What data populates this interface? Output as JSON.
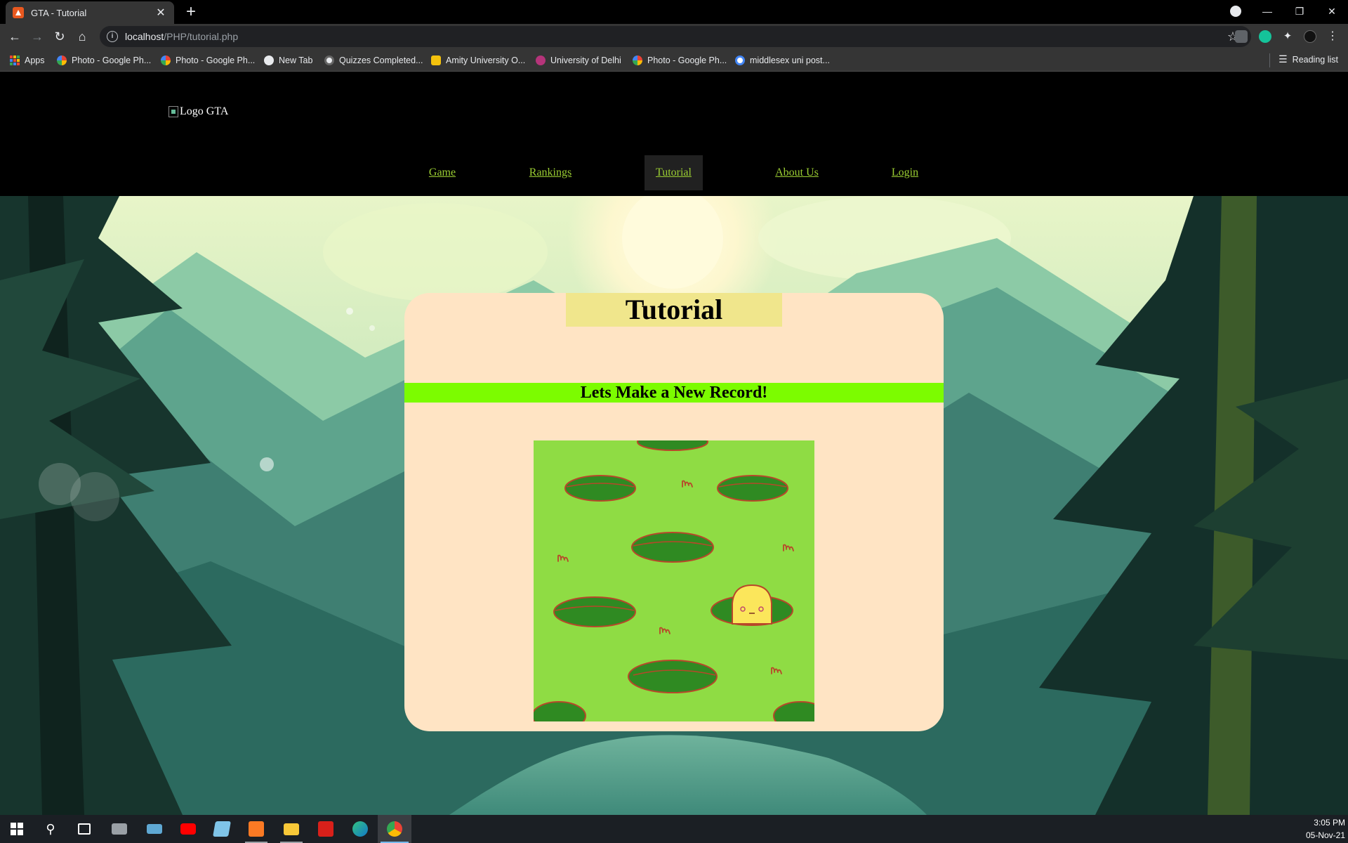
{
  "browser": {
    "tab_title": "GTA - Tutorial",
    "url_host": "localhost",
    "url_path": "/PHP/tutorial.php",
    "bookmarks": [
      {
        "label": "Apps",
        "icon": "apps-grid-icon",
        "color": "#4285f4"
      },
      {
        "label": "Photo - Google Ph...",
        "icon": "google-photos-icon",
        "color": "#fbbc05"
      },
      {
        "label": "Photo - Google Ph...",
        "icon": "google-photos-icon",
        "color": "#fbbc05"
      },
      {
        "label": "New Tab",
        "icon": "globe-icon",
        "color": "#e8eaed"
      },
      {
        "label": "Quizzes Completed...",
        "icon": "quiz-icon",
        "color": "#e8eaed"
      },
      {
        "label": "Amity University O...",
        "icon": "amity-icon",
        "color": "#f4c20d"
      },
      {
        "label": "University of Delhi",
        "icon": "du-icon",
        "color": "#b5347a"
      },
      {
        "label": "Photo - Google Ph...",
        "icon": "google-photos-icon",
        "color": "#fbbc05"
      },
      {
        "label": "middlesex uni post...",
        "icon": "google-icon",
        "color": "#ffffff"
      }
    ],
    "reading_list": "Reading list"
  },
  "site": {
    "logo_alt": "Logo GTA",
    "nav": [
      {
        "label": "Game",
        "active": false
      },
      {
        "label": "Rankings",
        "active": false
      },
      {
        "label": "Tutorial",
        "active": true
      },
      {
        "label": "About Us",
        "active": false
      },
      {
        "label": "Login",
        "active": false
      }
    ],
    "link_color": "#9acd32"
  },
  "card": {
    "title": "Tutorial",
    "subtitle": "Lets Make a New Record!",
    "bg_color": "#ffe4c4",
    "title_bg": "#f0e68c",
    "subtitle_bg": "#7cfc00"
  },
  "game": {
    "grass_color": "#8fdc44",
    "hole_color": "#2f8a22",
    "rim_color": "#b8472a",
    "mole_color": "#fbe65b"
  },
  "taskbar": {
    "apps": [
      "start-icon",
      "search-icon",
      "task-view-icon",
      "camera-icon",
      "laptop-icon",
      "youtube-icon",
      "notepad-icon",
      "xampp-icon",
      "file-explorer-icon",
      "acrobat-icon",
      "edge-icon",
      "chrome-icon"
    ],
    "time": "3:05 PM",
    "date": "05-Nov-21"
  }
}
